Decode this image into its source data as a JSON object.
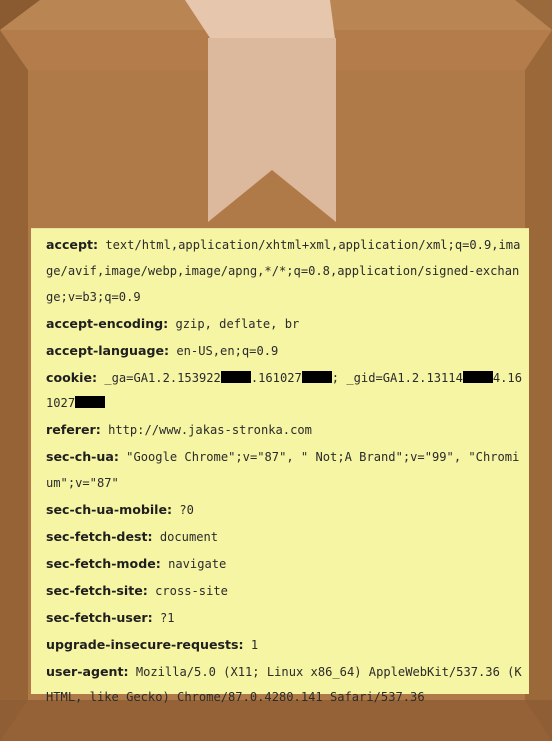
{
  "colors": {
    "box_main": "#b27c4b",
    "box_shadow": "#8e5e33",
    "ribbon": "#dfbca1",
    "label_bg": "#f6f5a4",
    "redaction": "#000000"
  },
  "icons": [
    "package-box-icon",
    "bookmark-ribbon-icon"
  ],
  "headers": [
    {
      "name": "accept:",
      "value": "text/html,application/xhtml+xml,application/xml;q=0.9,image/avif,image/webp,image/apng,*/*;q=0.8,application/signed-exchange;v=b3;q=0.9"
    },
    {
      "name": "accept-encoding:",
      "value": "gzip, deflate, br"
    },
    {
      "name": "accept-language:",
      "value": "en-US,en;q=0.9"
    },
    {
      "name": "cookie:",
      "value_parts": [
        "_ga=GA1.2.153922",
        ".161027",
        "; _gid=GA1.2.13114",
        "4.161027",
        ""
      ]
    },
    {
      "name": "referer:",
      "value": "http://www.jakas-stronka.com"
    },
    {
      "name": "sec-ch-ua:",
      "value": "\"Google Chrome\";v=\"87\", \" Not;A Brand\";v=\"99\", \"Chromium\";v=\"87\""
    },
    {
      "name": "sec-ch-ua-mobile:",
      "value": "?0"
    },
    {
      "name": "sec-fetch-dest:",
      "value": "document"
    },
    {
      "name": "sec-fetch-mode:",
      "value": "navigate"
    },
    {
      "name": "sec-fetch-site:",
      "value": "cross-site"
    },
    {
      "name": "sec-fetch-user:",
      "value": "?1"
    },
    {
      "name": "upgrade-insecure-requests:",
      "value": "1"
    },
    {
      "name": "user-agent:",
      "value": "Mozilla/5.0 (X11; Linux x86_64) AppleWebKit/537.36 (KHTML, like Gecko) Chrome/87.0.4280.141 Safari/537.36"
    }
  ]
}
